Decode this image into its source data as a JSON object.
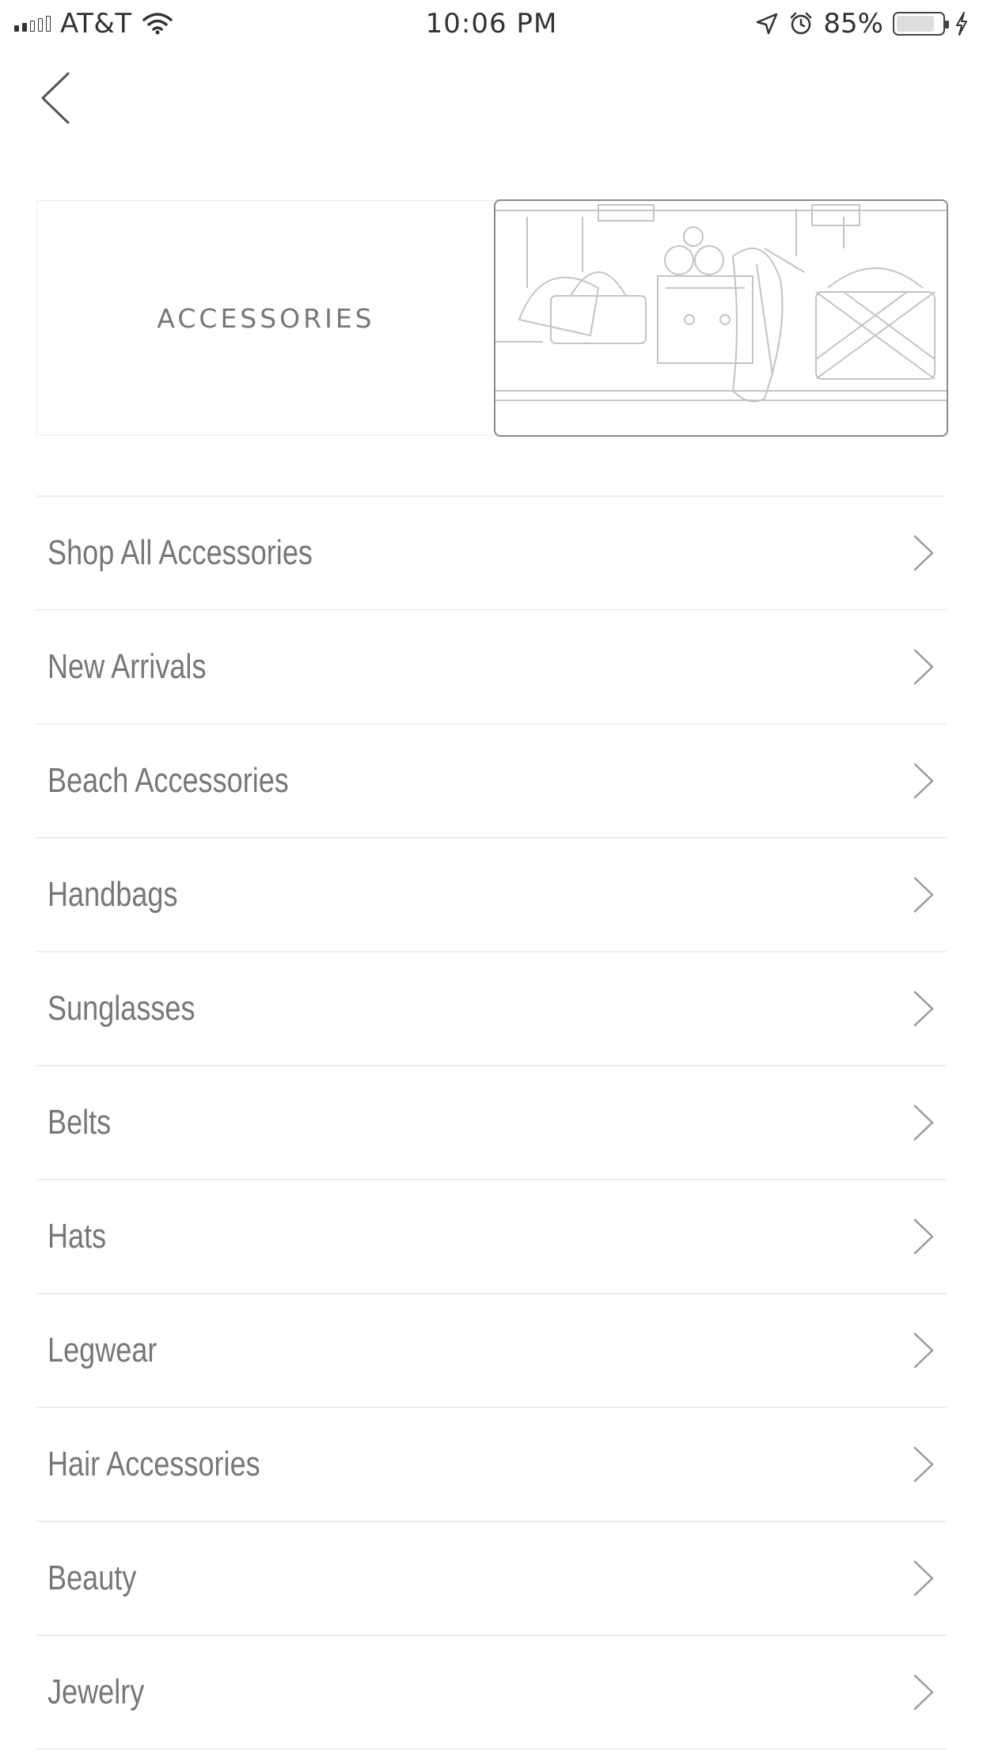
{
  "status_bar": {
    "carrier": "AT&T",
    "time": "10:06 PM",
    "battery_percent": "85%",
    "battery_level": 0.85,
    "icons": [
      "signal-icon",
      "wifi-icon",
      "location-arrow-icon",
      "alarm-icon",
      "battery-icon",
      "charging-bolt-icon"
    ]
  },
  "nav": {
    "back_icon": "chevron-left-icon"
  },
  "banner": {
    "title": "ACCESSORIES",
    "image_subject": "handbags-and-accessories-photo"
  },
  "categories": [
    {
      "label": "Shop All Accessories"
    },
    {
      "label": "New Arrivals"
    },
    {
      "label": "Beach Accessories"
    },
    {
      "label": "Handbags"
    },
    {
      "label": "Sunglasses"
    },
    {
      "label": "Belts"
    },
    {
      "label": "Hats"
    },
    {
      "label": "Legwear"
    },
    {
      "label": "Hair Accessories"
    },
    {
      "label": "Beauty"
    },
    {
      "label": "Jewelry"
    }
  ],
  "row_icon": "chevron-right-icon",
  "colors": {
    "background": "#ffffff",
    "text": "#777777",
    "divider": "#eeeeee"
  }
}
